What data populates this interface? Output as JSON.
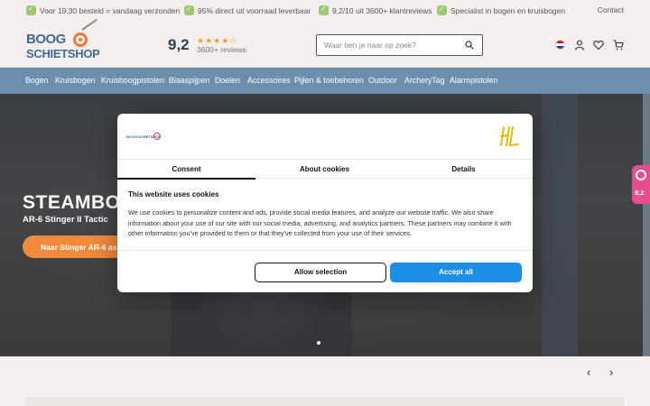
{
  "usp_bar": {
    "items": [
      "Voor 19:30 besteld = vandaag verzonden",
      "95% direct uit voorraad leverbaar",
      "9,2/10 uit 3600+ klantreviews",
      "Specialist in bogen en kruisbogen"
    ],
    "contact": "Contact"
  },
  "header": {
    "logo_line1": "BOOG",
    "logo_line2": "SCHIETSHOP",
    "rating_score": "9,2",
    "rating_stars": "★★★★☆",
    "rating_count": "3600+ reviews",
    "search_placeholder": "Waar ben je naar op zoek?"
  },
  "nav": {
    "items": [
      "Bogen",
      "Kruisbogen",
      "Kruisboogpistolen",
      "Blaaspijpen",
      "Doelen",
      "Accessoires",
      "Pijlen & toebehoren",
      "Outdoor",
      "ArcheryTag",
      "Alarmpistolen"
    ]
  },
  "hero": {
    "title": "STEAMBO",
    "subtitle": "AR-6 Stinger II Tactic",
    "button": "Naar Stinger AR-6 ass"
  },
  "side_badge": {
    "score": "9,2"
  },
  "cookie_dialog": {
    "logo_text": "BOOGSCHIETSHOP",
    "tabs": [
      "Consent",
      "About cookies",
      "Details"
    ],
    "active_tab": "Consent",
    "heading": "This website uses cookies",
    "body": "We use cookies to personalize content and ads, provide social media features, and analyze our website traffic. We also share information about your use of our site with our social media, advertising, and analytics partners. These partners may combine it with other information you've provided to them or that they've collected from your use of their services.",
    "allow_selection": "Allow selection",
    "accept_all": "Accept all"
  },
  "carousel": {
    "prev": "‹",
    "next": "›"
  },
  "colors": {
    "nav_bg": "#6c8fae",
    "accent_orange": "#f08a3c",
    "accept_blue": "#1b8ee6",
    "badge_pink": "#e84e8f"
  }
}
